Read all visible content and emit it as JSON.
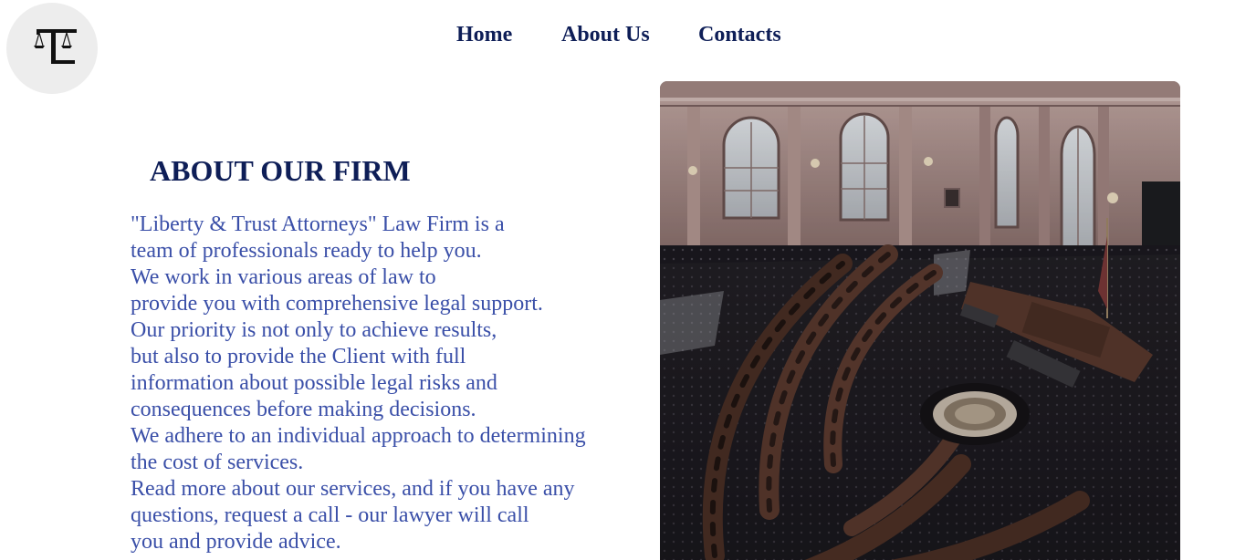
{
  "logo": {
    "icon": "scales-monogram-icon",
    "letters": "TL"
  },
  "nav": {
    "items": [
      {
        "label": "Home"
      },
      {
        "label": "About Us"
      },
      {
        "label": "Contacts"
      }
    ]
  },
  "about": {
    "title": "ABOUT OUR FIRM",
    "lines": [
      "\"Liberty & Trust Attorneys\" Law Firm is a",
      "team of professionals ready to help you.",
      "We work in various areas of law to",
      "provide you with comprehensive legal support.",
      "Our priority is not only to achieve results,",
      "but also to provide the Client with full",
      "information about possible legal risks and",
      "consequences before making decisions.",
      "We adhere to an individual approach to determining",
      "the cost of services.",
      "Read more about our services, and if you have any",
      "questions, request a call - our lawyer will call",
      "you and provide advice."
    ]
  },
  "image": {
    "subject": "legislative-chamber-photo"
  },
  "colors": {
    "nav_text": "#0e1e57",
    "heading": "#0e1e57",
    "body_text": "#3a4fa8",
    "logo_bg": "#ededed"
  }
}
